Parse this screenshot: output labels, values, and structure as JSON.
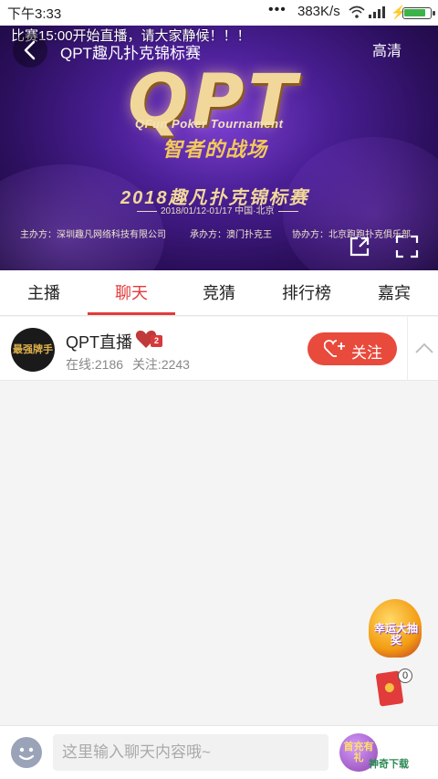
{
  "status_bar": {
    "time": "下午3:33",
    "dots": "•••",
    "speed": "383K/s",
    "battery_level": 0.9
  },
  "video": {
    "marquee": "比赛15:00开始直播，请大家静候！！！",
    "title": "QPT趣凡扑克锦标赛",
    "quality": "高清",
    "logo": "QPT",
    "tagline_en": "QFun Poker Tournament",
    "tagline_cn": "智者的战场",
    "event_title": "2018趣凡扑克锦标赛",
    "event_date": "2018/01/12-01/17 中国·北京",
    "sponsors": [
      "主办方：深圳趣凡网络科技有限公司",
      "承办方：澳门扑克王",
      "协办方：北京跑跑扑克俱乐部"
    ]
  },
  "tabs": [
    {
      "label": "主播"
    },
    {
      "label": "聊天",
      "active": true
    },
    {
      "label": "竞猜"
    },
    {
      "label": "排行榜"
    },
    {
      "label": "嘉宾"
    }
  ],
  "anchor": {
    "avatar_text": "最强牌手",
    "name": "QPT直播",
    "level": "2",
    "online": "在线:2186",
    "followers": "关注:2243",
    "follow_label": "关注"
  },
  "promo": {
    "text": "幸运大抽奖",
    "redpacket_count": "0"
  },
  "input_bar": {
    "placeholder": "这里输入聊天内容哦~",
    "gift_label": "首充有礼"
  },
  "watermark": "神奇下载",
  "colors": {
    "accent": "#e23b3b",
    "follow_button": "#e84a3c",
    "video_bg": "#4a1f95"
  }
}
